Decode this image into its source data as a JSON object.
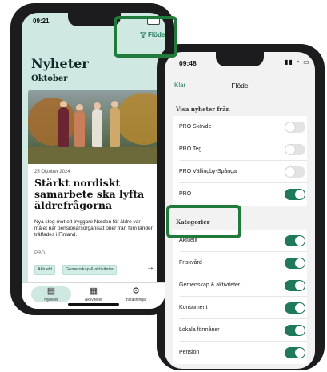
{
  "phone1": {
    "status_time": "09:21",
    "filter_label": "Flöde",
    "page_title": "Nyheter",
    "month": "Oktober",
    "article": {
      "date": "25 Oktober 2024",
      "title": "Stärkt nordiskt samarbete ska lyfta äldrefrågorna",
      "body": "Nya steg mot ett tryggare Norden för äldre var målet när pensionärsorganisat oner från fem länder träffades i Finland.",
      "org": "PRO",
      "tags": [
        "Aktuellt",
        "Gemenskap & aktiviteter"
      ]
    },
    "tabs": [
      {
        "label": "Nyheter",
        "icon": "newspaper-icon"
      },
      {
        "label": "Aktiviteter",
        "icon": "calendar-icon"
      },
      {
        "label": "Inställningar",
        "icon": "gear-icon"
      }
    ]
  },
  "phone2": {
    "status_time": "09:48",
    "nav": {
      "cancel": "Klar",
      "title": "Flöde"
    },
    "sections": [
      {
        "title": "Visa nyheter från",
        "rows": [
          {
            "label": "PRO Skövde",
            "on": false
          },
          {
            "label": "PRO Teg",
            "on": false
          },
          {
            "label": "PRO Vällingby-Spånga",
            "on": false
          },
          {
            "label": "PRO",
            "on": true
          }
        ]
      },
      {
        "title": "Kategorier",
        "rows": [
          {
            "label": "Aktuellt",
            "on": true
          },
          {
            "label": "Friskvård",
            "on": true
          },
          {
            "label": "Gemenskap & aktiviteter",
            "on": true
          },
          {
            "label": "Konsument",
            "on": true
          },
          {
            "label": "Lokala förmåner",
            "on": true
          },
          {
            "label": "Pension",
            "on": true
          }
        ]
      }
    ]
  },
  "colors": {
    "accent": "#1f7a5c",
    "highlight": "#1f7a3c",
    "mint": "#cfe9e2"
  }
}
